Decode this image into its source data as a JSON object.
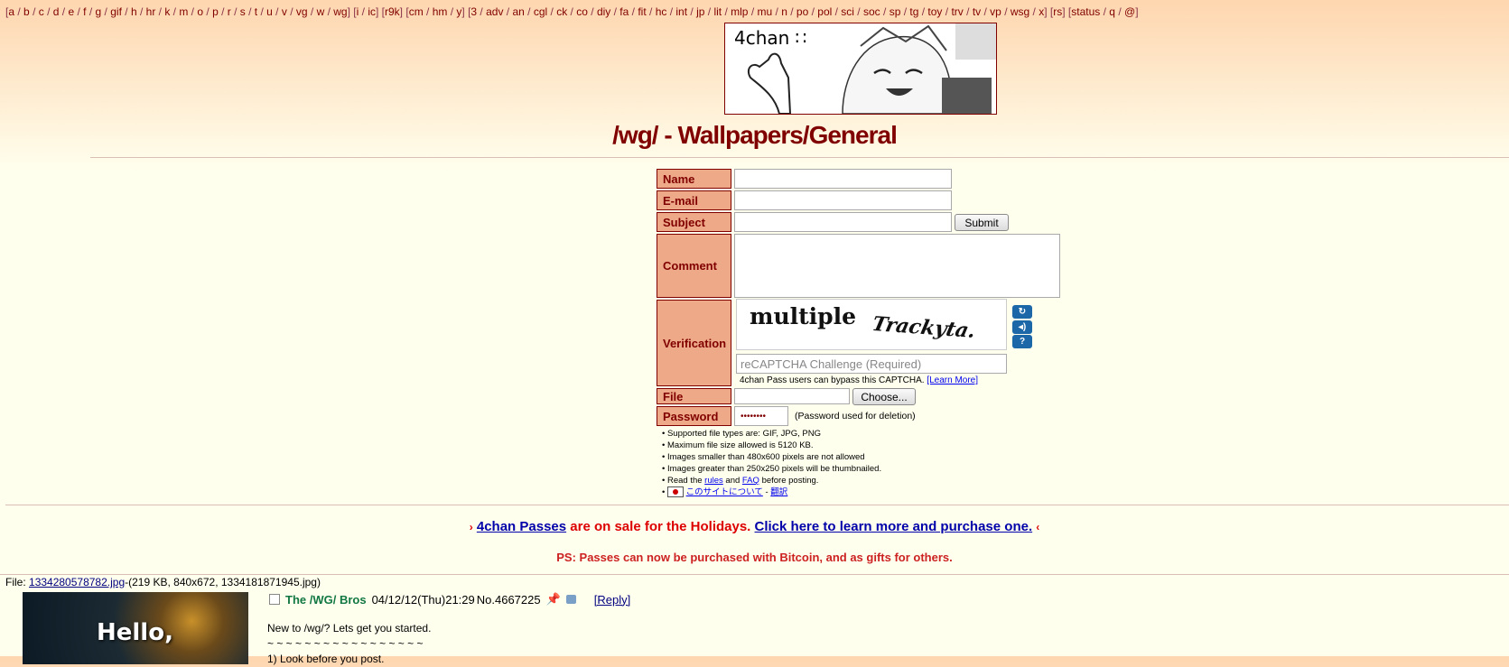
{
  "nav": {
    "groups": [
      [
        "a",
        "b",
        "c",
        "d",
        "e",
        "f",
        "g",
        "gif",
        "h",
        "hr",
        "k",
        "m",
        "o",
        "p",
        "r",
        "s",
        "t",
        "u",
        "v",
        "vg",
        "w",
        "wg"
      ],
      [
        "i",
        "ic"
      ],
      [
        "r9k"
      ],
      [
        "cm",
        "hm",
        "y"
      ],
      [
        "3",
        "adv",
        "an",
        "cgl",
        "ck",
        "co",
        "diy",
        "fa",
        "fit",
        "hc",
        "int",
        "jp",
        "lit",
        "mlp",
        "mu",
        "n",
        "po",
        "pol",
        "sci",
        "soc",
        "sp",
        "tg",
        "toy",
        "trv",
        "tv",
        "vp",
        "wsg",
        "x"
      ],
      [
        "rs"
      ],
      [
        "status",
        "q",
        "@"
      ]
    ]
  },
  "banner": {
    "logo_text": "4chan ∷"
  },
  "board": {
    "title": "/wg/ - Wallpapers/General"
  },
  "form": {
    "name_label": "Name",
    "email_label": "E-mail",
    "subject_label": "Subject",
    "submit_label": "Submit",
    "comment_label": "Comment",
    "verification_label": "Verification",
    "captcha_word1": "multiple",
    "captcha_word2": "Trackyta.",
    "captcha_placeholder": "reCAPTCHA Challenge (Required)",
    "pass_note": "4chan Pass users can bypass this CAPTCHA.",
    "learn_more": "[Learn More]",
    "file_label": "File",
    "choose_label": "Choose...",
    "password_label": "Password",
    "password_value": "••••••••",
    "password_note": "(Password used for deletion)"
  },
  "rules": {
    "r1": "Supported file types are: GIF, JPG, PNG",
    "r2": "Maximum file size allowed is 5120 KB.",
    "r3": "Images smaller than 480x600 pixels are not allowed",
    "r4": "Images greater than 250x250 pixels will be thumbnailed.",
    "r5_pre": "Read the",
    "r5_rules": "rules",
    "r5_and": "and",
    "r5_faq": "FAQ",
    "r5_post": "before posting.",
    "r6_jp": "このサイトについて",
    "r6_dash": "-",
    "r6_tr": "翻訳"
  },
  "promo": {
    "arrow_left": "›",
    "passes_link": "4chan Passes",
    "middle": "are on sale for the Holidays.",
    "click_link": "Click here to learn more and purchase one.",
    "arrow_right": "‹",
    "ps": "PS: Passes can now be purchased with Bitcoin, and as gifts for others."
  },
  "thread": {
    "file_prefix": "File:",
    "file_name": "1334280578782.jpg",
    "file_meta": "-(219 KB, 840x672, 1334181871945.jpg)",
    "thumb_text": "Hello,",
    "poster": "The /WG/ Bros",
    "date": "04/12/12(Thu)21:29",
    "post_no": "No.4667225",
    "reply": "[Reply]",
    "body_line1": "New to /wg/? Lets get you started.",
    "body_line2": "~ ~ ~ ~ ~ ~ ~ ~ ~ ~ ~ ~ ~ ~ ~ ~ ~",
    "body_line3": "1) Look before you post."
  }
}
